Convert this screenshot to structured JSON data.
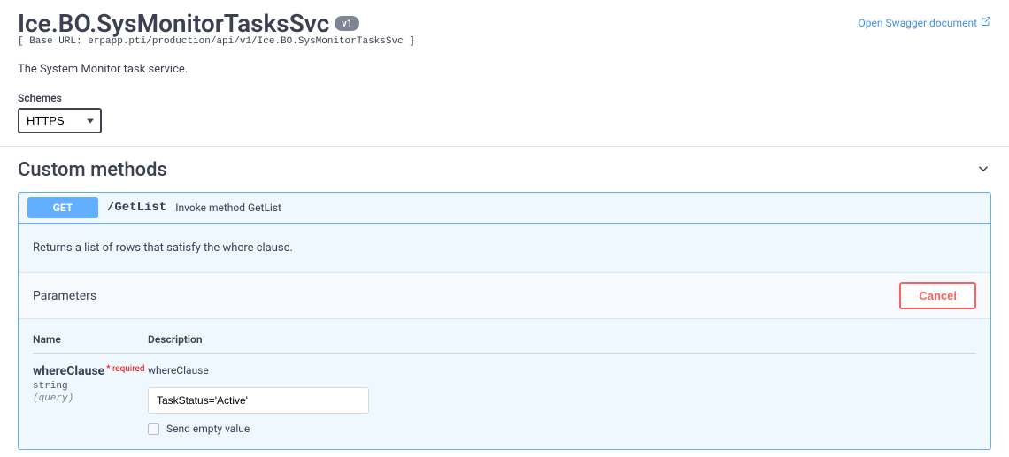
{
  "header": {
    "title": "Ice.BO.SysMonitorTasksSvc",
    "version": "v1",
    "base_url_label": "[ Base URL: erpapp.pti/production/api/v1/Ice.BO.SysMonitorTasksSvc ]",
    "description": "The System Monitor task service.",
    "open_swagger": "Open Swagger document"
  },
  "schemes": {
    "label": "Schemes",
    "selected": "HTTPS",
    "options": [
      "HTTPS"
    ]
  },
  "section": {
    "title": "Custom methods"
  },
  "operation": {
    "method": "GET",
    "path": "/GetList",
    "summary": "Invoke method GetList",
    "description": "Returns a list of rows that satisfy the where clause.",
    "parameters_label": "Parameters",
    "cancel_label": "Cancel",
    "columns": {
      "name": "Name",
      "description": "Description"
    },
    "param": {
      "name": "whereClause",
      "required": "* required",
      "type": "string",
      "in": "(query)",
      "desc": "whereClause",
      "value": "TaskStatus='Active'",
      "placeholder": "whereClause",
      "send_empty": "Send empty value"
    }
  },
  "chart_data": null
}
